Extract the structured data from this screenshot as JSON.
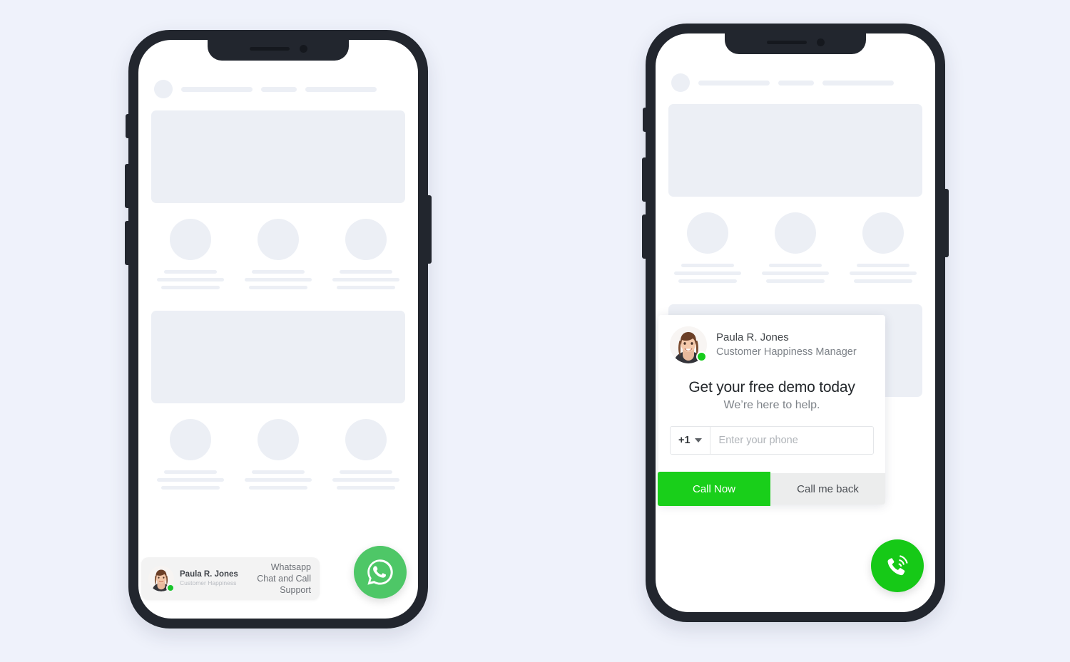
{
  "page": {
    "background_color": "#eff2fb",
    "frame_color": "#22262e"
  },
  "phones": [
    {
      "id": "whatsapp-phone",
      "widget_type": "whatsapp-chat-widget",
      "chip": {
        "agent_name": "Paula R. Jones",
        "agent_role": "Customer Happiness",
        "cta_line_1": "Whatsapp",
        "cta_line_2": "Chat and Call",
        "cta_line_3": "Support",
        "online": true,
        "background_color": "#f3f3f3"
      },
      "fab": {
        "icon": "whatsapp-icon",
        "color": "#4ec767"
      }
    },
    {
      "id": "callnow-phone",
      "widget_type": "call-now-widget",
      "card": {
        "agent_name": "Paula R. Jones",
        "agent_role": "Customer Happiness Manager",
        "online": true,
        "headline": "Get your free demo today",
        "subhead": "We’re here to help.",
        "country_code": "+1",
        "phone_value": "",
        "phone_placeholder": "Enter your phone",
        "primary_button": "Call Now",
        "secondary_button": "Call me back",
        "primary_color": "#19cf1a",
        "secondary_color": "#eceded"
      },
      "fab": {
        "icon": "phone-call-icon",
        "color": "#16c917"
      }
    }
  ],
  "skeleton": {
    "placeholder_color": "#eceff5",
    "nav_lines": 3,
    "hero_blocks": 2,
    "feature_columns": 3,
    "feature_rows": 2
  }
}
